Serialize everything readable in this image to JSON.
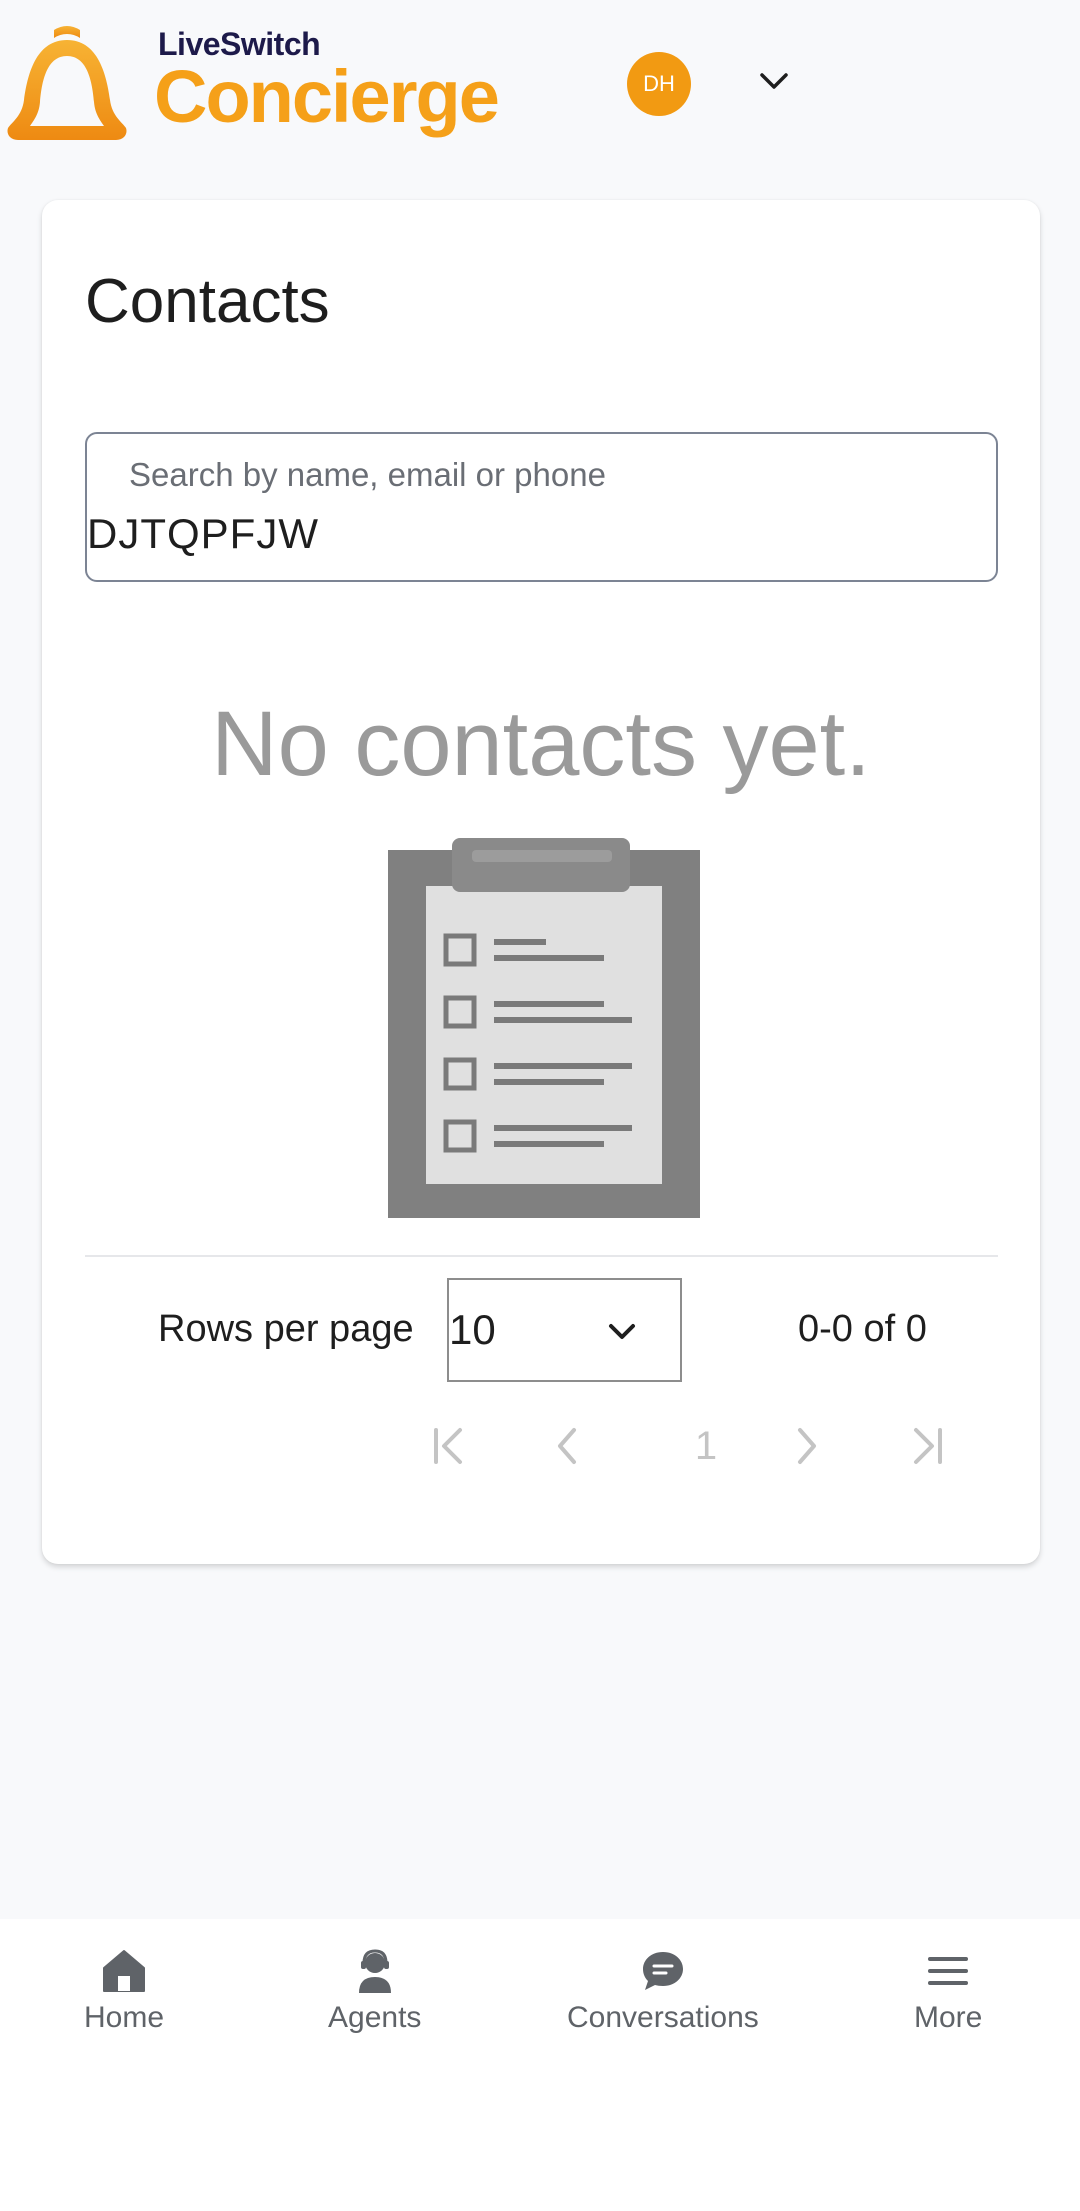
{
  "brand": {
    "top_text": "LiveSwitch",
    "main_text": "Concierge",
    "accent_color": "#f5a019"
  },
  "user": {
    "initials": "DH",
    "avatar_color": "#f29a12"
  },
  "contacts": {
    "title": "Contacts",
    "search": {
      "label": "Search by name, email or phone",
      "value": "DJTQPFJW"
    },
    "empty_message": "No contacts yet.",
    "pagination": {
      "rows_label": "Rows per page",
      "rows_value": "10",
      "range_text": "0-0 of 0",
      "current_page": "1"
    }
  },
  "nav": {
    "home": "Home",
    "agents": "Agents",
    "conversations": "Conversations",
    "more": "More"
  },
  "icons": [
    "bell-logo-icon",
    "chevron-down-icon",
    "clipboard-checklist-icon",
    "first-page-icon",
    "prev-page-icon",
    "next-page-icon",
    "last-page-icon",
    "home-icon",
    "agent-headset-icon",
    "chat-bubble-icon",
    "menu-icon"
  ]
}
